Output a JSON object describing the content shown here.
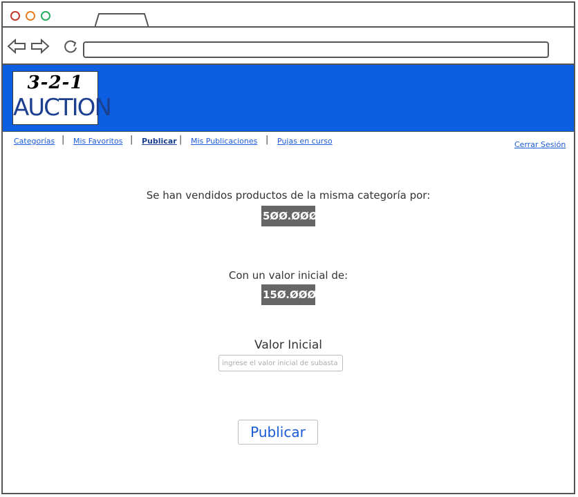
{
  "brand": {
    "logo_top": "3-2-1",
    "logo_bottom": "AUCTION",
    "header_color": "#0b5fe0"
  },
  "nav": {
    "items": [
      {
        "label": "Categorías"
      },
      {
        "label": "Mis Favoritos"
      },
      {
        "label": "Publicar"
      },
      {
        "label": "Mis Publicaciones"
      },
      {
        "label": "Pujas en curso"
      }
    ],
    "logout": "Cerrar Sesión"
  },
  "main": {
    "sold_label": "Se han vendidos productos de la misma categoría por:",
    "sold_value": "5ØØ.ØØØ",
    "initial_label": "Con un valor inicial de:",
    "initial_value": "15Ø.ØØØ",
    "valor_inicial_label": "Valor Inicial",
    "valor_inicial_placeholder": "ingrese el valor inicial de subasta",
    "publish_button": "Publicar"
  }
}
